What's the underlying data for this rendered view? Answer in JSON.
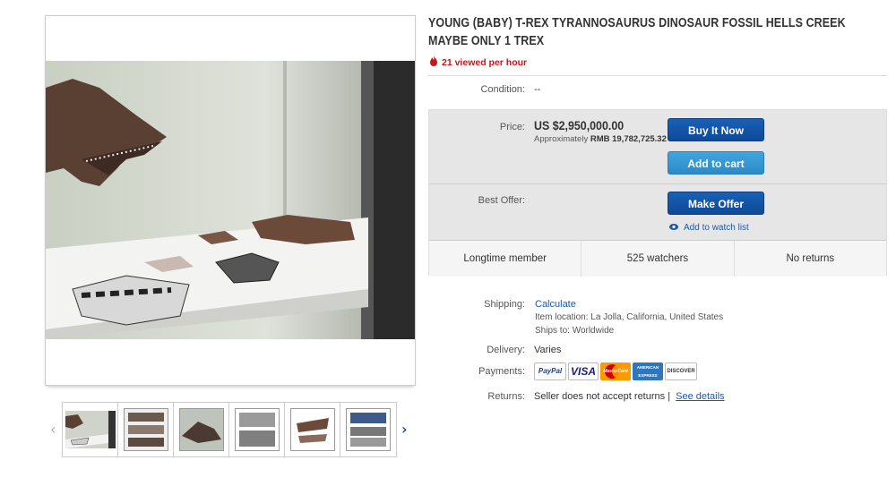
{
  "title": "YOUNG (BABY) T-REX TYRANNOSAURUS DINOSAUR FOSSIL HELLS CREEK MAYBE ONLY 1 TREX",
  "views": "21 viewed per hour",
  "condition": {
    "label": "Condition:",
    "value": "--"
  },
  "price": {
    "label": "Price:",
    "value": "US $2,950,000.00",
    "approx_label": "Approximately",
    "approx_value": "RMB 19,782,725.32"
  },
  "buttons": {
    "buy": "Buy It Now",
    "cart": "Add to cart",
    "offer": "Make Offer"
  },
  "best_offer_label": "Best Offer:",
  "watch_label": "Add to watch list",
  "stats": [
    "Longtime member",
    "525 watchers",
    "No returns"
  ],
  "shipping": {
    "label": "Shipping:",
    "value": "Calculate",
    "location": "Item location: La Jolla, California, United States",
    "ships_to": "Ships to: Worldwide"
  },
  "delivery": {
    "label": "Delivery:",
    "value": "Varies"
  },
  "payments": {
    "label": "Payments:",
    "methods": [
      "PayPal",
      "VISA",
      "MasterCard",
      "AMERICAN EXPRESS",
      "DISCOVER"
    ]
  },
  "returns": {
    "label": "Returns:",
    "value": "Seller does not accept returns |",
    "link": "See details"
  },
  "gallery": {
    "thumbnail_count": 6,
    "selected": 0
  },
  "colors": {
    "primary_button": "#0e4a9a",
    "secondary_button": "#2b8bc9",
    "link": "#1c5aa8",
    "alert": "#c4161c"
  }
}
